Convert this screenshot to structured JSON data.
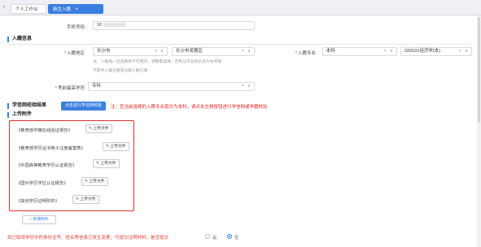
{
  "tabs": {
    "collapse_icon": "«",
    "items": [
      {
        "label": "个人工作台"
      },
      {
        "label": "新生入籍",
        "close": "×"
      }
    ]
  },
  "phone": {
    "label": "手机号码",
    "value": "1€"
  },
  "section_enroll": {
    "title": "入籍信息"
  },
  "enroll_area": {
    "label": "入籍地区",
    "province": "长沙市",
    "district": "长沙市芙蓉区",
    "hint_line1": "注：入籍地一旦选择将不可更改，调整需选择，否则与市总的信息为本考察",
    "hint_line2": "不提供入籍注册或注册人数已满"
  },
  "major": {
    "label": "入籍专业",
    "level": "本科",
    "major": "020101经济学(本)"
  },
  "education": {
    "label": "考前最高学历",
    "value": "专科"
  },
  "verify": {
    "title": "学信网校验结果",
    "button": "点击进行学信网校验",
    "message": "注：您当前选择的入籍专业层次为本科，请点击左侧按钮进行学信网或学籍校验"
  },
  "section_attach": {
    "title": "上传附件"
  },
  "attachments": [
    {
      "label": "《教育部学籍在线验证报告》",
      "button": "上传文件"
    },
    {
      "label": "《教育部学历证书电子注册备案表》",
      "button": "上传文件"
    },
    {
      "label": "《中国高等教育学历认证报告》",
      "button": "上传文件"
    },
    {
      "label": "《国外学历学位认证报告》",
      "button": "上传文件"
    },
    {
      "label": "《其他学历证明附件》",
      "button": "上传文件"
    }
  ],
  "add_attachment": "+ 新增附件",
  "change_question": "如已取得学历中的身份证号、姓名等信息已发生变更，可提交证明材料，是否提交",
  "radio": {
    "yes": "是",
    "no": "否",
    "selected": "no"
  },
  "colors": {
    "accent": "#3a7ee0",
    "error": "#e02020",
    "required": "#e02020"
  },
  "icons": {
    "clear": "×",
    "dropdown": "∨",
    "upload": "✎"
  }
}
